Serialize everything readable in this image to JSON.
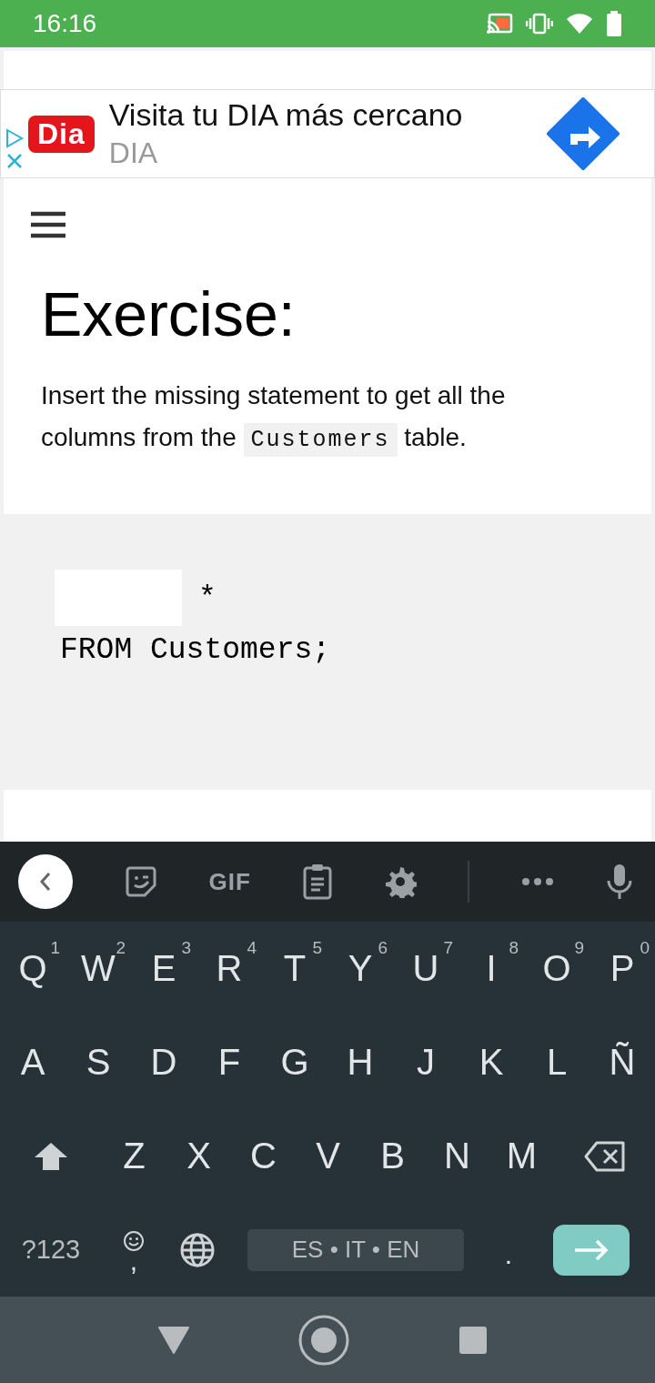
{
  "status_bar": {
    "time": "16:16"
  },
  "ad": {
    "logo": "Dia",
    "title": "Visita tu DIA más cercano",
    "advertiser": "DIA"
  },
  "exercise": {
    "heading": "Exercise:",
    "instruction": {
      "before": "Insert the missing statement to get all the columns from the",
      "code": "Customers",
      "after": "table."
    },
    "after_blank": "*",
    "line_2": "FROM Customers;"
  },
  "keyboard": {
    "toolbar": [
      {
        "kind": "back"
      },
      {
        "kind": "sticker"
      },
      {
        "kind": "gif",
        "label": "GIF"
      },
      {
        "kind": "clipboard"
      },
      {
        "kind": "settings"
      },
      {
        "kind": "divider"
      },
      {
        "kind": "more"
      },
      {
        "kind": "mic"
      }
    ],
    "letter_rows": [
      {
        "keys": [
          {
            "kind": "letter",
            "label": "Q",
            "hint": "1"
          },
          {
            "kind": "letter",
            "label": "W",
            "hint": "2"
          },
          {
            "kind": "letter",
            "label": "E",
            "hint": "3"
          },
          {
            "kind": "letter",
            "label": "R",
            "hint": "4"
          },
          {
            "kind": "letter",
            "label": "T",
            "hint": "5"
          },
          {
            "kind": "letter",
            "label": "Y",
            "hint": "6"
          },
          {
            "kind": "letter",
            "label": "U",
            "hint": "7"
          },
          {
            "kind": "letter",
            "label": "I",
            "hint": "8"
          },
          {
            "kind": "letter",
            "label": "O",
            "hint": "9"
          },
          {
            "kind": "letter",
            "label": "P",
            "hint": "0"
          }
        ]
      },
      {
        "keys": [
          {
            "kind": "letter",
            "label": "A"
          },
          {
            "kind": "letter",
            "label": "S"
          },
          {
            "kind": "letter",
            "label": "D"
          },
          {
            "kind": "letter",
            "label": "F"
          },
          {
            "kind": "letter",
            "label": "G"
          },
          {
            "kind": "letter",
            "label": "H"
          },
          {
            "kind": "letter",
            "label": "J"
          },
          {
            "kind": "letter",
            "label": "K"
          },
          {
            "kind": "letter",
            "label": "L"
          },
          {
            "kind": "letter",
            "label": "Ñ"
          }
        ]
      },
      {
        "keys": [
          {
            "kind": "shift"
          },
          {
            "kind": "letter",
            "label": "Z"
          },
          {
            "kind": "letter",
            "label": "X"
          },
          {
            "kind": "letter",
            "label": "C"
          },
          {
            "kind": "letter",
            "label": "V"
          },
          {
            "kind": "letter",
            "label": "B"
          },
          {
            "kind": "letter",
            "label": "N"
          },
          {
            "kind": "letter",
            "label": "M"
          },
          {
            "kind": "backspace"
          }
        ]
      }
    ],
    "bottom_row": {
      "keys": [
        {
          "kind": "symbols",
          "label": "?123"
        },
        {
          "kind": "comma",
          "label": ","
        },
        {
          "kind": "globe"
        },
        {
          "kind": "space",
          "label": "ES • IT • EN"
        },
        {
          "kind": "period",
          "label": "."
        },
        {
          "kind": "enter"
        }
      ]
    }
  }
}
